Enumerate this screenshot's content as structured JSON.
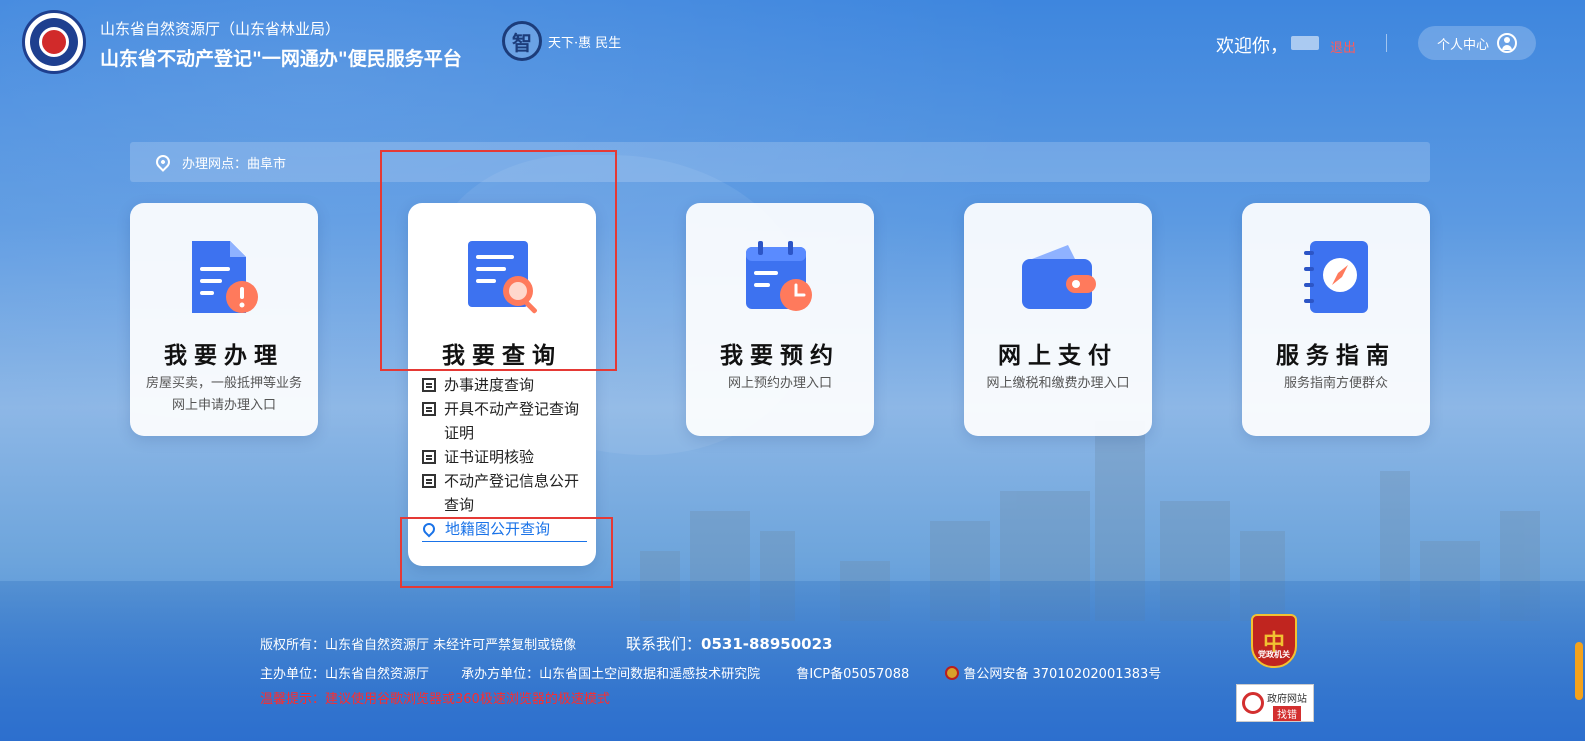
{
  "header": {
    "org_name": "山东省自然资源厅（山东省林业局）",
    "platform_name": "山东省不动产登记\"一网通办\"便民服务平台",
    "slogan_badge": "智",
    "slogan_text": "天下·惠 民生",
    "welcome": "欢迎你，",
    "logout": "退出",
    "user_center": "个人中心"
  },
  "location": {
    "text": "办理网点：曲阜市"
  },
  "cards": [
    {
      "title": "我要办理",
      "desc": "房屋买卖，一般抵押等业务网上申请办理入口"
    },
    {
      "title": "我要查询",
      "desc": ""
    },
    {
      "title": "我要预约",
      "desc": "网上预约办理入口"
    },
    {
      "title": "网上支付",
      "desc": "网上缴税和缴费办理入口"
    },
    {
      "title": "服务指南",
      "desc": "服务指南方便群众"
    }
  ],
  "query_menu": [
    "办事进度查询",
    "开具不动产登记查询证明",
    "证书证明核验",
    "不动产登记信息公开查询",
    "地籍图公开查询"
  ],
  "footer": {
    "copyright": "版权所有：山东省自然资源厅 未经许可严禁复制或镜像",
    "contact_label": "联系我们：",
    "contact_phone": "0531-88950023",
    "host": "主办单位：山东省自然资源厅",
    "undertaker": "承办方单位：山东省国土空间数据和遥感技术研究院",
    "icp": "鲁ICP备05057088",
    "police": "鲁公网安备 37010202001383号",
    "tip": "温馨提示：建议使用谷歌浏览器或360极速浏览器的极速模式",
    "gov_badge_1": "政府网站",
    "gov_badge_2": "找错",
    "party_badge": "党政机关"
  },
  "colors": {
    "accent_blue": "#1a73e8",
    "annotation_red": "#e53935",
    "tip_red": "#ff2c2c"
  }
}
